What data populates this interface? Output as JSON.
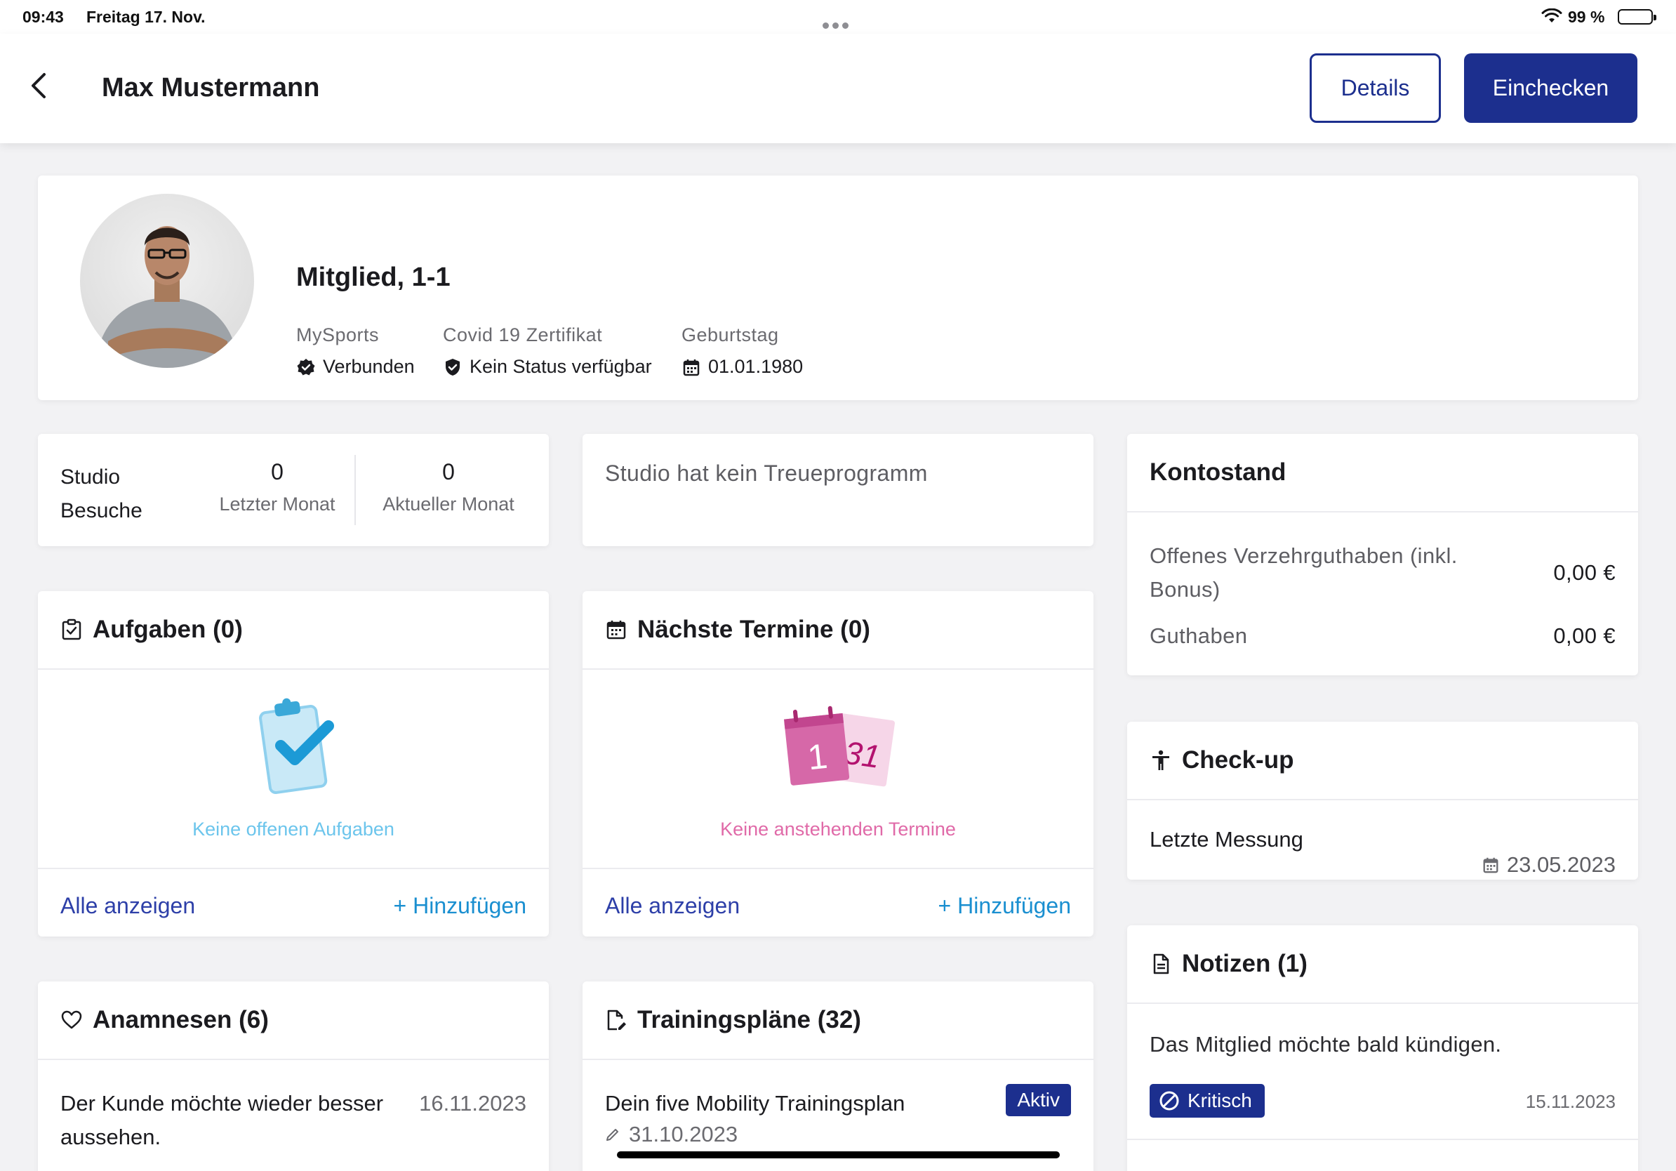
{
  "status_bar": {
    "time": "09:43",
    "date": "Freitag 17. Nov.",
    "battery": "99 %",
    "battery_level": 0.99
  },
  "header": {
    "title": "Max Mustermann",
    "details_label": "Details",
    "checkin_label": "Einchecken"
  },
  "profile": {
    "title": "Mitglied, 1-1",
    "fields": [
      {
        "label": "MySports",
        "value": "Verbunden",
        "icon": "verified-badge-icon"
      },
      {
        "label": "Covid 19 Zertifikat",
        "value": "Kein Status verfügbar",
        "icon": "shield-check-icon"
      },
      {
        "label": "Geburtstag",
        "value": "01.01.1980",
        "icon": "calendar-icon"
      }
    ]
  },
  "visits": {
    "label_line1": "Studio",
    "label_line2": "Besuche",
    "last_month_value": "0",
    "last_month_label": "Letzter Monat",
    "current_month_value": "0",
    "current_month_label": "Aktueller Monat"
  },
  "loyalty": {
    "text": "Studio hat kein Treueprogramm"
  },
  "konto": {
    "title": "Kontostand",
    "rows": [
      {
        "label_line1": "Offenes Verzehrguthaben (inkl.",
        "label_line2": "Bonus)",
        "value": "0,00 €"
      },
      {
        "label": "Guthaben",
        "value": "0,00 €"
      }
    ]
  },
  "tasks": {
    "title": "Aufgaben (0)",
    "empty": "Keine offenen Aufgaben",
    "show_all": "Alle anzeigen",
    "add": "+ Hinzufügen",
    "empty_color": "#6cc5ec"
  },
  "appointments": {
    "title": "Nächste Termine (0)",
    "empty": "Keine anstehenden Termine",
    "show_all": "Alle anzeigen",
    "add": "+ Hinzufügen",
    "empty_color": "#e06aa8",
    "illus_day1": "1",
    "illus_day2": "31"
  },
  "checkup": {
    "title": "Check-up",
    "label": "Letzte Messung",
    "date": "23.05.2023"
  },
  "notes": {
    "title": "Notizen (1)",
    "text": "Das Mitglied möchte bald kündigen.",
    "badge": "Kritisch",
    "date": "15.11.2023"
  },
  "anamnesen": {
    "title": "Anamnesen (6)",
    "text": "Der Kunde möchte wieder besser aussehen.",
    "date": "16.11.2023"
  },
  "plans": {
    "title": "Trainingspläne (32)",
    "text": "Dein five Mobility Trainingsplan",
    "badge": "Aktiv",
    "date": "31.10.2023"
  },
  "colors": {
    "primary": "#1c2f8e",
    "link": "#2d3fa8",
    "add_link": "#1a8fd0"
  }
}
